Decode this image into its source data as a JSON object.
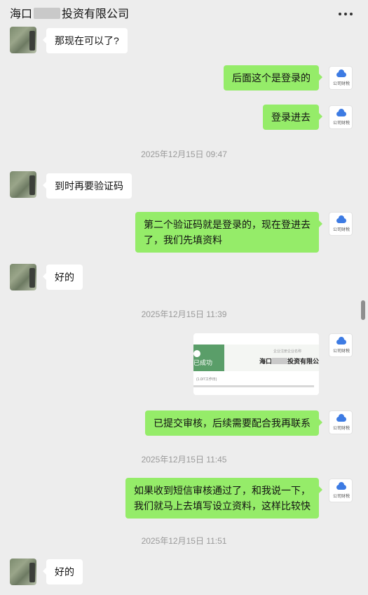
{
  "header": {
    "title_pre": "海口",
    "title_post": "投资有限公司"
  },
  "avatar_right_label": "公司财税",
  "messages": [
    {
      "text": "那现在可以了?"
    },
    {
      "text": "后面这个是登录的"
    },
    {
      "text": "登录进去"
    },
    {
      "text": "2025年12月15日 09:47"
    },
    {
      "text": "到时再要验证码"
    },
    {
      "text_line1": "第二个验证码就是登录的，现在登进去",
      "text_line2": "了，我们先填资料"
    },
    {
      "text": "好的"
    },
    {
      "text": "2025年12月15日 11:39"
    },
    {
      "card_left": "已成功",
      "card_small": "企业注册企业名称",
      "card_name_pre": "海口",
      "card_name_post": "投资有限公司",
      "card_line": "(1.0/7工作日)"
    },
    {
      "text": "已提交审核，后续需要配合我再联系"
    },
    {
      "text": "2025年12月15日 11:45"
    },
    {
      "text_line1": "如果收到短信审核通过了，和我说一下，",
      "text_line2": "我们就马上去填写设立资料，这样比较快"
    },
    {
      "text": "2025年12月15日 11:51"
    },
    {
      "text": "好的"
    }
  ]
}
